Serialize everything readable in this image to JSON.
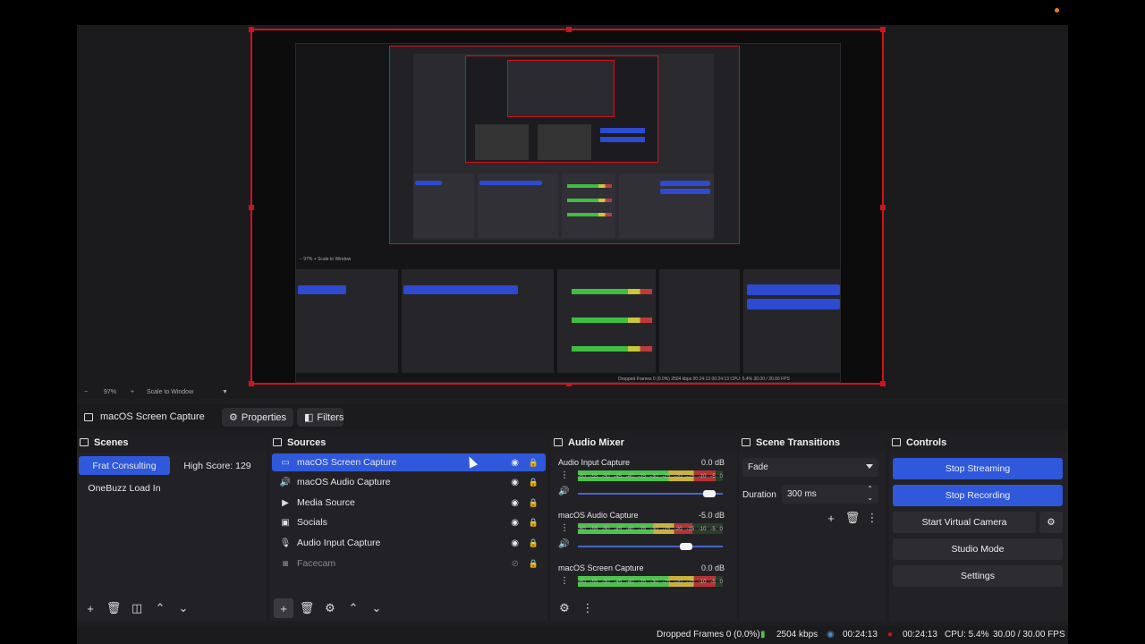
{
  "colors": {
    "accent": "#2f58da",
    "selection_border": "#d0131b",
    "background": "#1e1e21"
  },
  "zoom": {
    "minus": "−",
    "percent": "97%",
    "plus": "+",
    "mode": "Scale to Window"
  },
  "context_bar": {
    "source": "macOS Screen Capture",
    "properties": "Properties",
    "filters": "Filters"
  },
  "scenes": {
    "title": "Scenes",
    "items": [
      "Frat Consulting",
      "High Score: 129",
      "OneBuzz Load In"
    ],
    "active_index": 0
  },
  "sources": {
    "title": "Sources",
    "items": [
      {
        "name": "macOS Screen Capture",
        "icon": "monitor-icon",
        "visible": true
      },
      {
        "name": "macOS Audio Capture",
        "icon": "speaker-icon",
        "visible": true
      },
      {
        "name": "Media Source",
        "icon": "play-icon",
        "visible": true
      },
      {
        "name": "Socials",
        "icon": "image-icon",
        "visible": true
      },
      {
        "name": "Audio Input Capture",
        "icon": "microphone-icon",
        "visible": true
      },
      {
        "name": "Facecam",
        "icon": "camera-icon",
        "visible": false
      }
    ]
  },
  "audio_mixer": {
    "title": "Audio Mixer",
    "channels": [
      {
        "name": "Audio Input Capture",
        "db": "0.0 dB",
        "level": 0.95
      },
      {
        "name": "macOS Audio Capture",
        "db": "-5.0 dB",
        "level": 0.79
      },
      {
        "name": "macOS Screen Capture",
        "db": "0.0 dB",
        "level": 0.95
      }
    ],
    "scale": [
      "-60",
      "-55",
      "-50",
      "-45",
      "-40",
      "-35",
      "-30",
      "-25",
      "-20",
      "-15",
      "-10",
      "-5",
      "0"
    ]
  },
  "scene_transitions": {
    "title": "Scene Transitions",
    "transition": "Fade",
    "duration_label": "Duration",
    "duration_value": "300 ms"
  },
  "controls": {
    "title": "Controls",
    "stop_streaming": "Stop Streaming",
    "stop_recording": "Stop Recording",
    "start_virtual_camera": "Start Virtual Camera",
    "studio_mode": "Studio Mode",
    "settings": "Settings"
  },
  "status": {
    "dropped_frames": "Dropped Frames 0 (0.0%)",
    "bitrate": "2504 kbps",
    "stream_time": "00:24:13",
    "rec_time": "00:24:13",
    "cpu": "CPU: 5.4%",
    "fps": "30.00 / 30.00 FPS"
  }
}
